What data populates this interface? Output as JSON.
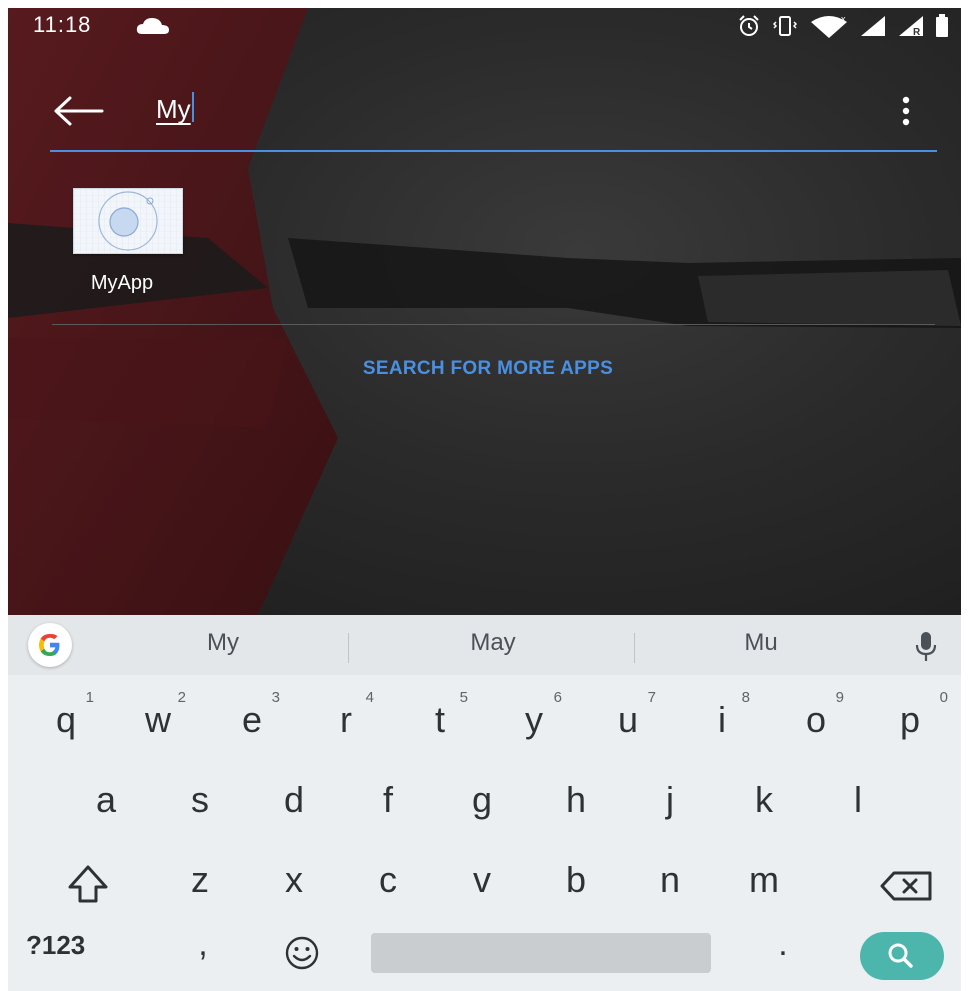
{
  "status_bar": {
    "time": "11:18",
    "left_icons": [
      "cloud-icon"
    ],
    "right_icons": [
      "alarm-icon",
      "vibrate-icon",
      "wifi-icon",
      "signal-icon",
      "signal-roaming-icon",
      "battery-icon"
    ]
  },
  "search": {
    "query": "My",
    "back_icon": "arrow-left-icon",
    "menu_icon": "overflow-menu-icon"
  },
  "results": [
    {
      "label": "MyApp",
      "icon": "myapp-icon"
    }
  ],
  "search_more_label": "SEARCH FOR MORE APPS",
  "keyboard": {
    "suggestions": [
      "My",
      "May",
      "Mu"
    ],
    "row1": [
      {
        "key": "q",
        "hint": "1"
      },
      {
        "key": "w",
        "hint": "2"
      },
      {
        "key": "e",
        "hint": "3"
      },
      {
        "key": "r",
        "hint": "4"
      },
      {
        "key": "t",
        "hint": "5"
      },
      {
        "key": "y",
        "hint": "6"
      },
      {
        "key": "u",
        "hint": "7"
      },
      {
        "key": "i",
        "hint": "8"
      },
      {
        "key": "o",
        "hint": "9"
      },
      {
        "key": "p",
        "hint": "0"
      }
    ],
    "row2": [
      "a",
      "s",
      "d",
      "f",
      "g",
      "h",
      "j",
      "k",
      "l"
    ],
    "row3": [
      "z",
      "x",
      "c",
      "v",
      "b",
      "n",
      "m"
    ],
    "symbols_label": "?123",
    "comma": ",",
    "period": ".",
    "accent_color": "#4db6ac"
  },
  "colors": {
    "accent": "#4a90e2"
  }
}
